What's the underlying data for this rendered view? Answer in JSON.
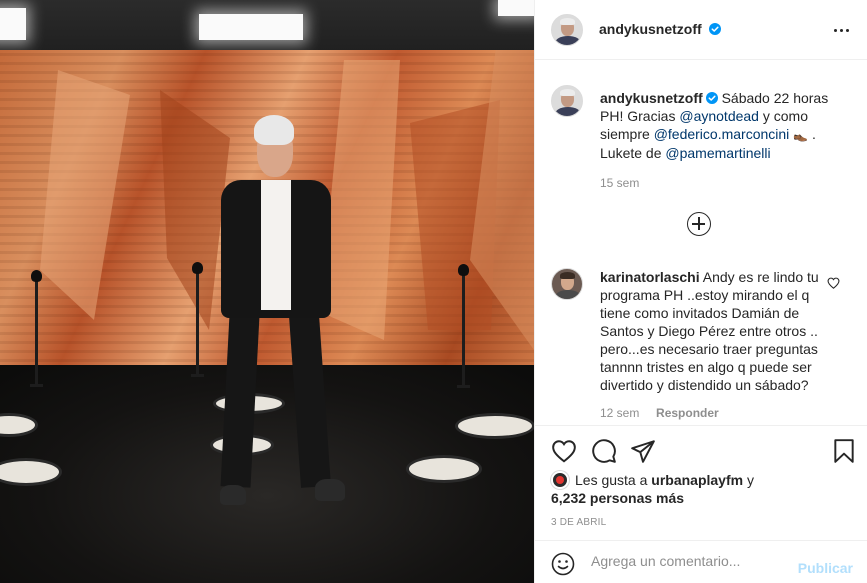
{
  "post": {
    "photo": {
      "subject": "man-in-suit-on-tv-set",
      "wall_color": "#c46a3a",
      "floor_color": "#141312"
    },
    "username": "andykusnetzoff",
    "verified_icon": "verified-badge-icon",
    "caption": {
      "text_1": "Sábado 22 horas PH! Gracias ",
      "mention_1": "@aynotdead",
      "text_2": " y como siempre ",
      "mention_2": "@federico.marconcini",
      "emoji": "👞",
      "text_3": " . Lukete de ",
      "mention_3": "@pamemartinelli",
      "age": "15 sem"
    },
    "comment": {
      "username": "karinatorlaschi",
      "text": "Andy es re lindo tu programa PH ..estoy mirando el q tiene como invitados Damián de Santos y Diego Pérez entre otros .. pero...es necesario traer preguntas tannnn tristes en algo q puede ser divertido y distendido un sábado?",
      "age": "12 sem",
      "reply_label": "Responder"
    },
    "likes": {
      "prefix": "Les gusta a ",
      "liker": "urbanaplayfm",
      "mid": " y ",
      "others": "6,232 personas más"
    },
    "date": "3 DE ABRIL",
    "add_comment": {
      "placeholder": "Agrega un comentario...",
      "publish_label": "Publicar"
    },
    "colors": {
      "link": "#00376b",
      "verified": "#0095f6",
      "publish_disabled": "#b2dffc",
      "muted": "#8e8e8e"
    }
  }
}
